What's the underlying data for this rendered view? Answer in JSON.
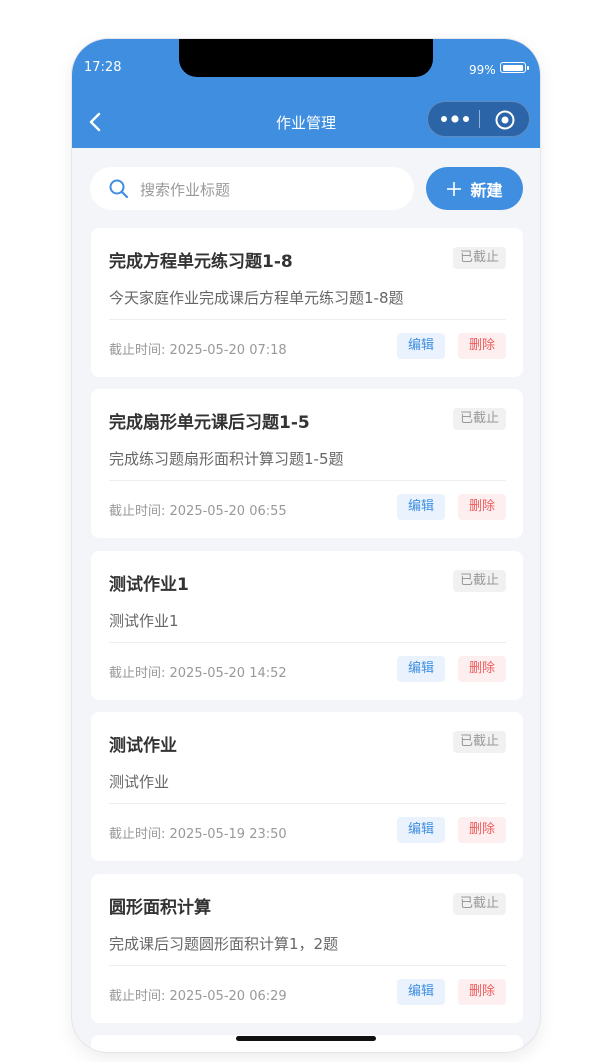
{
  "status_bar": {
    "time": "17:28",
    "battery_percent": "99%",
    "battery_level": 0.99
  },
  "nav": {
    "title": "作业管理",
    "back_icon": "chevron-left-icon",
    "menu_icon": "more-dots-icon",
    "close_icon": "target-circle-icon"
  },
  "search": {
    "placeholder": "搜索作业标题",
    "value": "",
    "icon": "search-icon"
  },
  "new_button": {
    "label": "新建",
    "icon": "plus-icon"
  },
  "homework_list": [
    {
      "title": "完成方程单元练习题1-8",
      "status": "已截止",
      "description": "今天家庭作业完成课后方程单元练习题1-8题",
      "deadline": "截止时间: 2025-05-20 07:18",
      "edit_label": "编辑",
      "delete_label": "删除"
    },
    {
      "title": "完成扇形单元课后习题1-5",
      "status": "已截止",
      "description": "完成练习题扇形面积计算习题1-5题",
      "deadline": "截止时间: 2025-05-20 06:55",
      "edit_label": "编辑",
      "delete_label": "删除"
    },
    {
      "title": "测试作业1",
      "status": "已截止",
      "description": "测试作业1",
      "deadline": "截止时间: 2025-05-20 14:52",
      "edit_label": "编辑",
      "delete_label": "删除"
    },
    {
      "title": "测试作业",
      "status": "已截止",
      "description": "测试作业",
      "deadline": "截止时间: 2025-05-19 23:50",
      "edit_label": "编辑",
      "delete_label": "删除"
    },
    {
      "title": "圆形面积计算",
      "status": "已截止",
      "description": "完成课后习题圆形面积计算1，2题",
      "deadline": "截止时间: 2025-05-20 06:29",
      "edit_label": "编辑",
      "delete_label": "删除"
    }
  ],
  "colors": {
    "primary": "#3f8ee0",
    "background": "#f4f5f9",
    "edit_bg": "#eaf3fd",
    "delete_text": "#f05a5a",
    "delete_bg": "#fdeff0"
  }
}
